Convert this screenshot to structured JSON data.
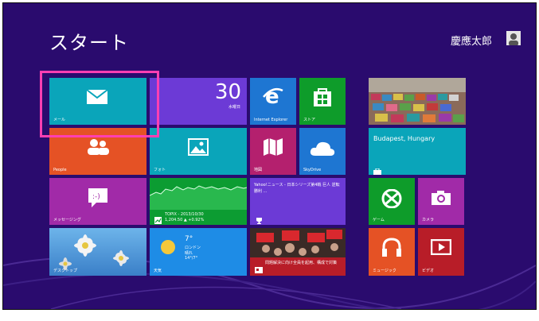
{
  "start": {
    "title": "スタート",
    "user": "慶應太郎"
  },
  "tiles": {
    "mail": {
      "label": "メール",
      "color": "#0aa5ba"
    },
    "calendar": {
      "day": "30",
      "weekday": "水曜日",
      "color": "#6c3ad6"
    },
    "ie": {
      "label": "Internet Explorer",
      "color": "#1e76d2"
    },
    "store": {
      "label": "ストア",
      "color": "#0e9c2a"
    },
    "travel": {
      "label": "Budapest, Hungary",
      "color": "#0aa5ba"
    },
    "people": {
      "label": "People",
      "color": "#e55225"
    },
    "photos": {
      "label": "フォト",
      "color": "#0aa5ba"
    },
    "maps": {
      "label": "地図",
      "color": "#b4206e"
    },
    "skydrive": {
      "label": "SkyDrive",
      "color": "#1e76d2"
    },
    "messaging": {
      "label": "メッセージング",
      "color": "#a12aa8"
    },
    "finance": {
      "title": "TOPIX - 2013/10/30",
      "value": "1,204.50 ▲ +0.92%",
      "color": "#0c9c32"
    },
    "news_sports": {
      "text": "Yahoo!ニュース - 日本シリーズ第4戦 巨人 逆転勝利 ...",
      "color": "#6c3ad6"
    },
    "games": {
      "label": "ゲーム",
      "color": "#0e9c2a"
    },
    "camera": {
      "label": "カメラ",
      "color": "#a12aa8"
    },
    "desktop": {
      "label": "デスクトップ"
    },
    "weather": {
      "temp": "7°",
      "city": "ロンドン",
      "cond": "晴れ",
      "range": "14°/7°",
      "label": "天気",
      "color": "#1e8ce6"
    },
    "news": {
      "headline": "問題解決に向け全員を起用、構成で対策",
      "color": "#b81d28"
    },
    "music": {
      "label": "ミュージック",
      "color": "#e55225"
    },
    "video": {
      "label": "ビデオ",
      "color": "#b81d28"
    }
  }
}
